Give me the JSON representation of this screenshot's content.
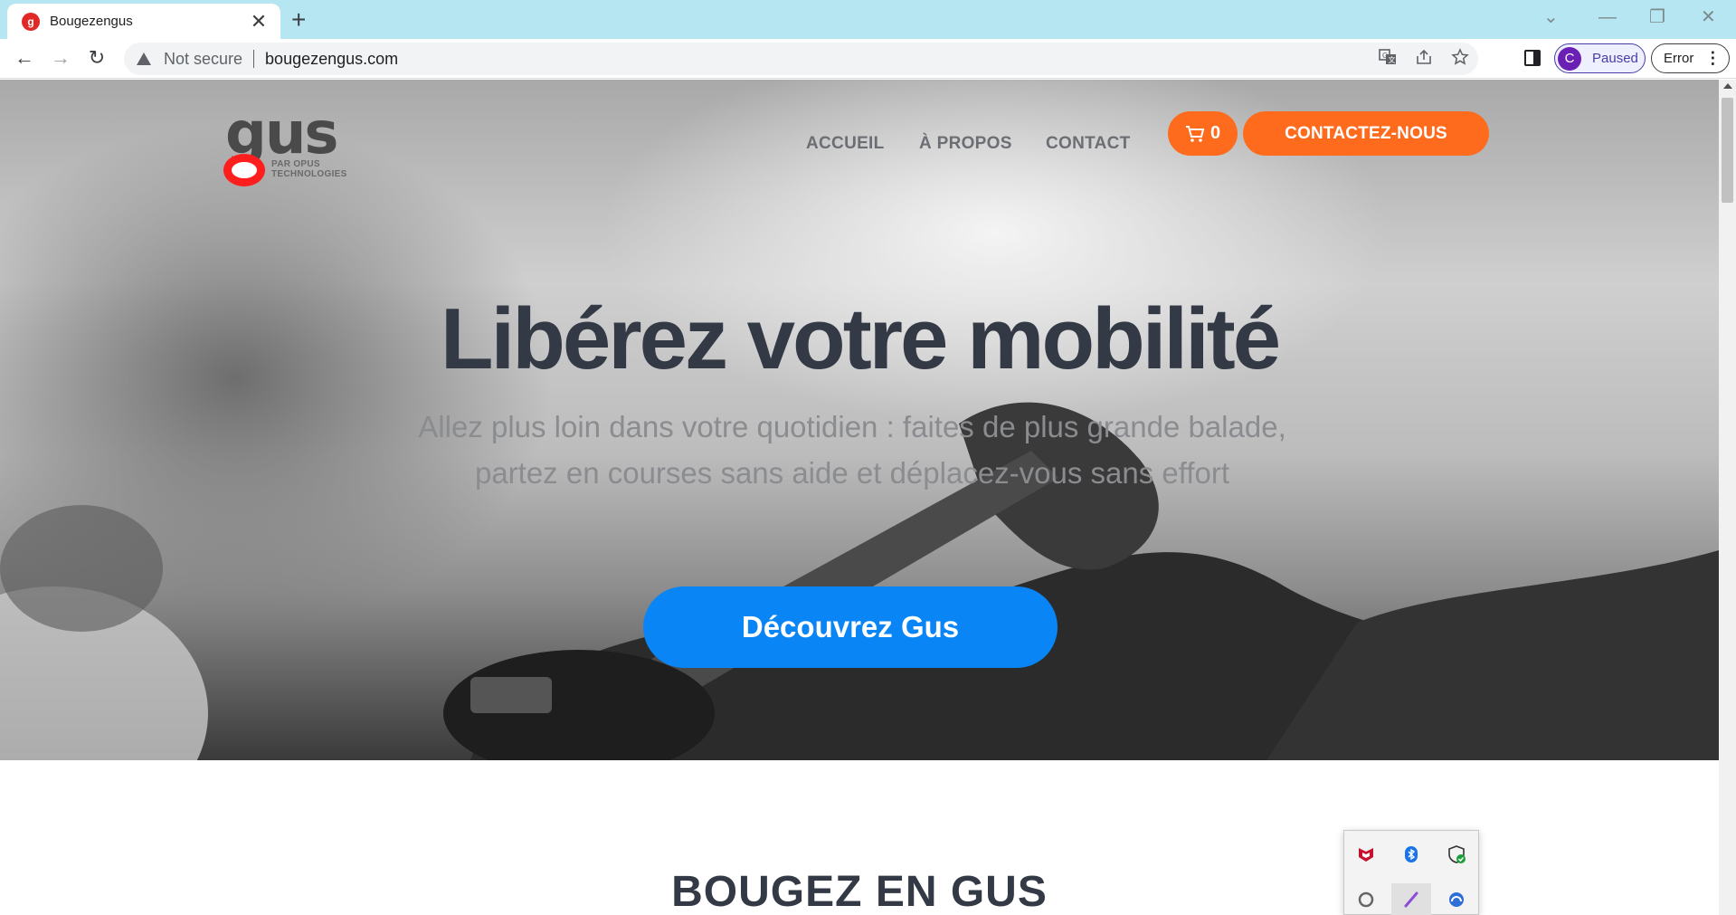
{
  "browser": {
    "tab": {
      "favicon": "g",
      "title": "Bougezengus",
      "close": "✕"
    },
    "new_tab": "+",
    "window_controls": {
      "tab_search": "⌄",
      "minimize": "—",
      "restore": "❐",
      "close": "✕"
    },
    "nav": {
      "back": "←",
      "forward": "→",
      "reload": "↻"
    },
    "omnibox": {
      "security_label": "Not secure",
      "url": "bougezengus.com"
    },
    "omni_icons": [
      "translate-icon",
      "share-icon",
      "star-icon"
    ],
    "profile": {
      "initial": "C",
      "status": "Paused",
      "accent": "#6a1fb5"
    },
    "error_chip": {
      "label": "Error"
    }
  },
  "site": {
    "logo": {
      "text": "gus",
      "subtitle_line1": "PAR OPUS",
      "subtitle_line2": "TECHNOLOGIES",
      "accent": "#ff1e1e"
    },
    "nav": [
      {
        "label": "ACCUEIL"
      },
      {
        "label": "À PROPOS"
      },
      {
        "label": "CONTACT"
      }
    ],
    "cart": {
      "count": "0"
    },
    "contact_button": {
      "label": "CONTACTEZ-NOUS",
      "color": "#ff6b1c"
    },
    "hero": {
      "title": "Libérez votre mobilité",
      "subtitle": "Allez plus loin dans votre quotidien : faites de plus grande balade, partez en courses sans aide et déplacez-vous sans effort",
      "cta": "Découvrez Gus",
      "cta_color": "#0a85f5"
    },
    "section_title": "BOUGEZ EN GUS"
  },
  "tray": {
    "icons": [
      "mcafee-icon",
      "bluetooth-icon",
      "security-shield-icon",
      "creative-cloud-icon",
      "pen-icon",
      "cloud-sync-icon"
    ]
  }
}
